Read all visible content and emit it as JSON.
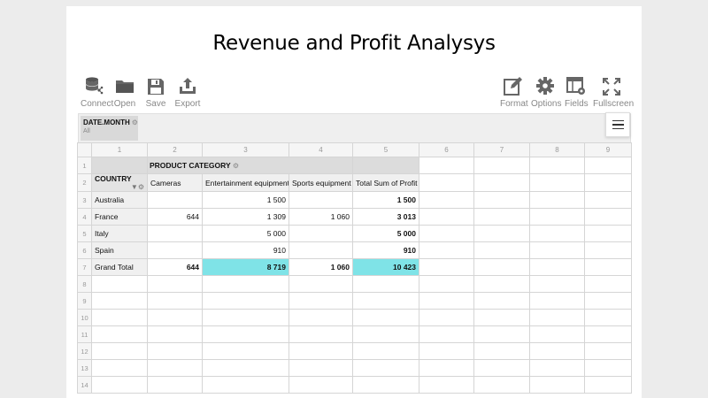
{
  "title": "Revenue and Profit Analysys",
  "toolbar": {
    "connect": "Connect",
    "open": "Open",
    "save": "Save",
    "export": "Export",
    "format": "Format",
    "options": "Options",
    "fields": "Fields",
    "fullscreen": "Fullscreen"
  },
  "filter": {
    "name": "DATE.MONTH",
    "value": "All"
  },
  "col_headers": [
    "1",
    "2",
    "3",
    "4",
    "5",
    "6",
    "7",
    "8",
    "9"
  ],
  "row_numbers": [
    "1",
    "2",
    "3",
    "4",
    "5",
    "6",
    "7",
    "8",
    "9",
    "10",
    "11",
    "12",
    "13",
    "14"
  ],
  "pivot": {
    "column_field": "PRODUCT CATEGORY",
    "row_field": "COUNTRY",
    "headers": [
      "Cameras",
      "Entertainment equipment",
      "Sports equipment",
      "Total Sum of Profit"
    ],
    "rows": [
      {
        "label": "Australia",
        "c1": "",
        "c2": "1 500",
        "c3": "",
        "total": "1 500"
      },
      {
        "label": "France",
        "c1": "644",
        "c2": "1 309",
        "c3": "1 060",
        "total": "3 013"
      },
      {
        "label": "Italy",
        "c1": "",
        "c2": "5 000",
        "c3": "",
        "total": "5 000"
      },
      {
        "label": "Spain",
        "c1": "",
        "c2": "910",
        "c3": "",
        "total": "910"
      }
    ],
    "grand_total": {
      "label": "Grand Total",
      "c1": "644",
      "c2": "8 719",
      "c3": "1 060",
      "total": "10 423"
    },
    "highlight_color": "#7fe3e7"
  }
}
